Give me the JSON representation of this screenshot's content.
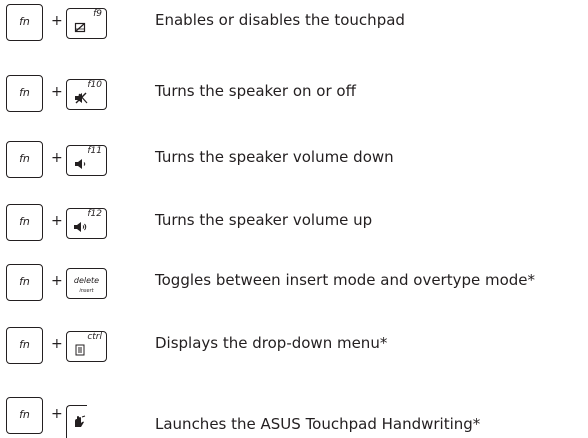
{
  "rows": [
    {
      "modifier": "fn",
      "plus": "+",
      "key_label": "f9",
      "key_icon": "touchpad-icon",
      "description": "Enables or disables the touchpad"
    },
    {
      "modifier": "fn",
      "plus": "+",
      "key_label": "f10",
      "key_icon": "speaker-mute-icon",
      "description": "Turns the speaker on or off"
    },
    {
      "modifier": "fn",
      "plus": "+",
      "key_label": "f11",
      "key_icon": "volume-down-icon",
      "description": "Turns the speaker volume down"
    },
    {
      "modifier": "fn",
      "plus": "+",
      "key_label": "f12",
      "key_icon": "volume-up-icon",
      "description": "Turns the speaker volume up"
    },
    {
      "modifier": "fn",
      "plus": "+",
      "key_label": "delete",
      "key_sublabel": "insert",
      "description": "Toggles between insert mode and overtype mode*"
    },
    {
      "modifier": "fn",
      "plus": "+",
      "key_label": "ctrl",
      "key_icon": "menu-icon",
      "description": "Displays the drop-down menu*"
    },
    {
      "modifier": "fn",
      "plus": "+",
      "key_icon": "handwriting-icon",
      "description": "Launches the ASUS Touchpad Handwriting*"
    }
  ]
}
